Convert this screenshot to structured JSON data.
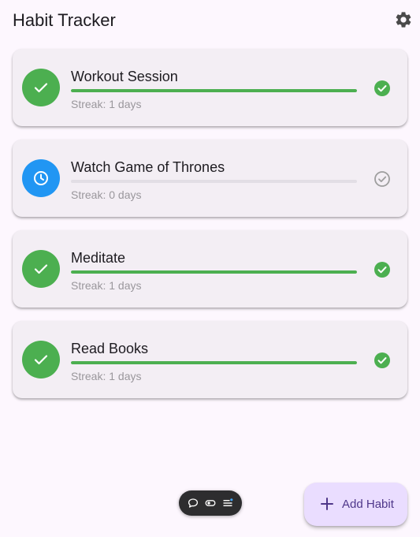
{
  "app": {
    "title": "Habit Tracker"
  },
  "colors": {
    "background": "#fdf7fe",
    "card": "#f3eef4",
    "success_green": "#4caf50",
    "pending_blue": "#2196f3",
    "pending_gray": "#9e9e9e",
    "fab_bg": "#eaddff",
    "fab_text": "#4f378a"
  },
  "habits": [
    {
      "name": "Workout Session",
      "streak_text": "Streak: 1 days",
      "progress": 1.0,
      "completed": true,
      "avatar_icon": "check-icon",
      "status_icon": "check-circle-icon"
    },
    {
      "name": "Watch Game of Thrones",
      "streak_text": "Streak: 0 days",
      "progress": 0.0,
      "completed": false,
      "avatar_icon": "clock-icon",
      "status_icon": "check-circle-outline-icon"
    },
    {
      "name": "Meditate",
      "streak_text": "Streak: 1 days",
      "progress": 1.0,
      "completed": true,
      "avatar_icon": "check-icon",
      "status_icon": "check-circle-icon"
    },
    {
      "name": "Read Books",
      "streak_text": "Streak: 1 days",
      "progress": 1.0,
      "completed": true,
      "avatar_icon": "check-icon",
      "status_icon": "check-circle-icon"
    }
  ],
  "fab": {
    "label": "Add Habit",
    "icon": "plus-icon"
  },
  "toolbar": {
    "icons": [
      "comment-icon",
      "toggle-icon",
      "list-settings-icon"
    ]
  }
}
